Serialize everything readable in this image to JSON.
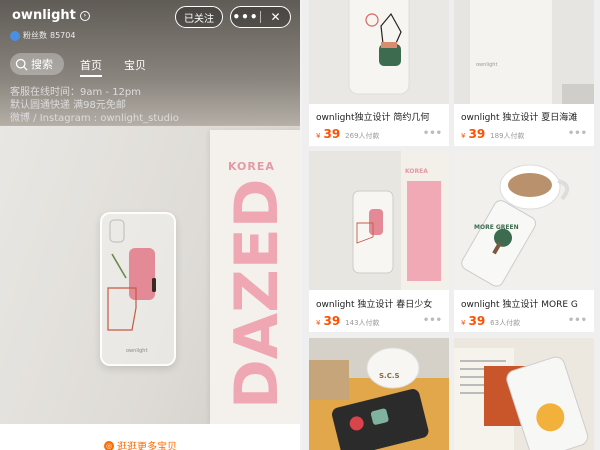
{
  "store": {
    "name": "ownlight",
    "fans_label": "粉丝数",
    "fans_count": "85704",
    "follow_label": "已关注",
    "more_label": "•••",
    "close_label": "✕"
  },
  "nav": {
    "search_label": "搜索",
    "tabs": [
      {
        "label": "首页",
        "active": true
      },
      {
        "label": "宝贝",
        "active": false
      }
    ]
  },
  "info": {
    "line1": "客服在线时间：9am - 12pm",
    "line2": "默认圆通快递 满98元免邮",
    "line3": "微博 / Instagram : ownlight_studio"
  },
  "hero": {
    "magazine_korea": "KOREA",
    "magazine_title": "DAZED",
    "brand_tag": "ownlight"
  },
  "more_items": {
    "label": "逛逛更多宝贝"
  },
  "products": [
    {
      "title": "ownlight独立设计 简约几何",
      "currency": "¥",
      "price": "39",
      "sold": "269人付款"
    },
    {
      "title": "ownlight 独立设计 夏日海滩",
      "currency": "¥",
      "price": "39",
      "sold": "189人付款"
    },
    {
      "title": "ownlight 独立设计 春日少女",
      "currency": "¥",
      "price": "39",
      "sold": "143人付款"
    },
    {
      "title": "ownlight 独立设计 MORE G",
      "currency": "¥",
      "price": "39",
      "sold": "63人付款"
    },
    {
      "title": "",
      "currency": "",
      "price": "",
      "sold": ""
    },
    {
      "title": "",
      "currency": "",
      "price": "",
      "sold": ""
    }
  ],
  "product_images": {
    "p4_card_text": "MORE GREEN",
    "p5_mug_text": "S.C.S"
  },
  "colors": {
    "accent_orange": "#ff5000",
    "pink": "#f0a7b4",
    "green": "#3d6b4f",
    "mustard": "#e0a02a"
  }
}
